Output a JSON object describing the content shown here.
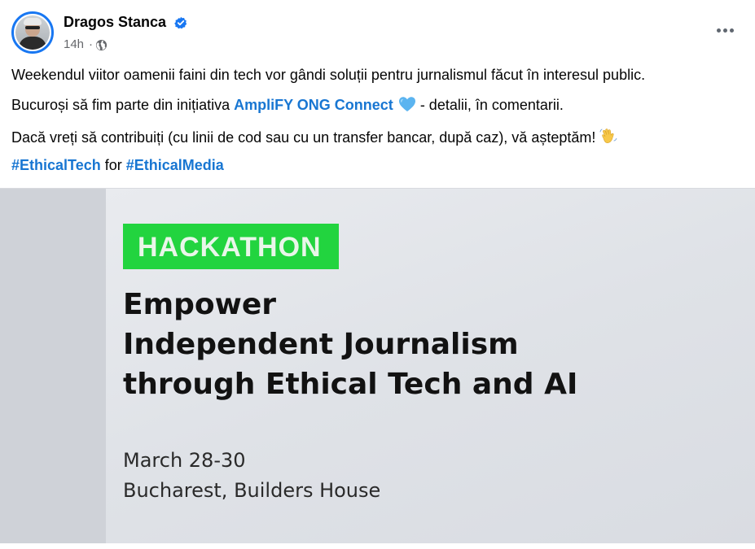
{
  "author": {
    "name": "Dragos Stanca",
    "verified": true,
    "timestamp": "14h",
    "separator": "·",
    "audience_icon": "globe-icon"
  },
  "post": {
    "line1": "Weekendul viitor oamenii faini din tech vor gândi soluții pentru jurnalismul făcut în interesul public.",
    "line2_prefix": "Bucuroși să fim parte din inițiativa ",
    "line2_link": "AmpliFY ONG Connect",
    "line2_emoji": "blue-heart-icon",
    "line2_suffix": " - detalii, în comentarii.",
    "line3": "Dacă vreți să contribuiți (cu linii de cod sau cu un transfer bancar, după caz), vă așteptăm!",
    "line3_emoji": "waving-hand-icon",
    "hashtag1": "#EthicalTech",
    "between": " for ",
    "hashtag2": "#EthicalMedia"
  },
  "image": {
    "badge": "HACKATHON",
    "title_line1": "Empower",
    "title_line2": "Independent Journalism",
    "title_line3": "through Ethical Tech and AI",
    "date": "March 28-30",
    "location": "Bucharest, Builders House"
  },
  "colors": {
    "link": "#1876d2",
    "verified": "#1877f2",
    "badge_green": "#22d43f"
  }
}
